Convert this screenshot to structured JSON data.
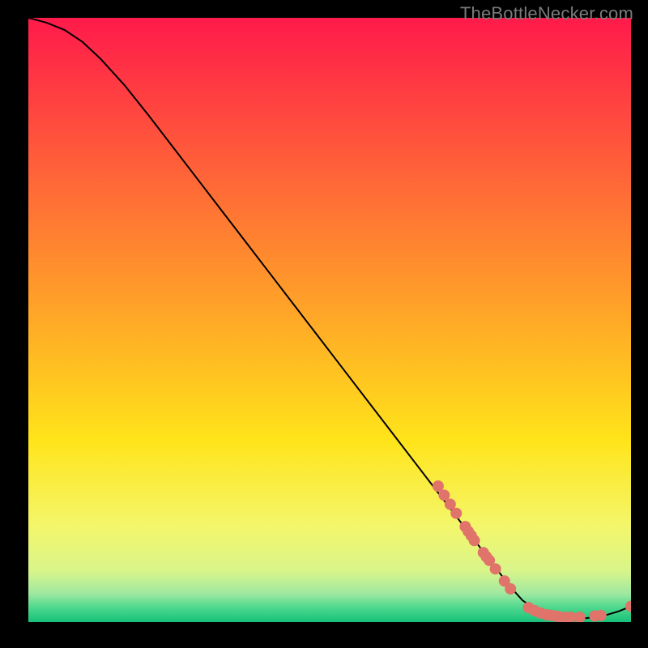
{
  "watermark": "TheBottleNecker.com",
  "chart_data": {
    "type": "line",
    "title": "",
    "xlabel": "",
    "ylabel": "",
    "xlim": [
      0,
      100
    ],
    "ylim": [
      0,
      100
    ],
    "grid": false,
    "legend": false,
    "background_gradient": {
      "stops": [
        {
          "offset": 0,
          "color": "#ff1a4b"
        },
        {
          "offset": 0.45,
          "color": "#ff9a2a"
        },
        {
          "offset": 0.7,
          "color": "#ffe41a"
        },
        {
          "offset": 0.84,
          "color": "#f4f66a"
        },
        {
          "offset": 0.915,
          "color": "#d9f58a"
        },
        {
          "offset": 0.953,
          "color": "#9fe8a0"
        },
        {
          "offset": 0.975,
          "color": "#4fd98e"
        },
        {
          "offset": 1.0,
          "color": "#17c07a"
        }
      ]
    },
    "series": [
      {
        "name": "curve",
        "color": "#000000",
        "x": [
          0,
          3,
          6,
          9,
          12,
          16,
          20,
          24,
          28,
          32,
          36,
          40,
          44,
          48,
          52,
          56,
          60,
          64,
          68,
          70,
          72,
          74,
          76,
          78,
          80,
          82,
          84,
          86,
          88,
          90,
          92,
          94,
          96,
          98,
          100
        ],
        "y": [
          100,
          99.2,
          98.0,
          96.0,
          93.2,
          88.8,
          83.8,
          78.6,
          73.4,
          68.2,
          63.0,
          57.8,
          52.6,
          47.4,
          42.2,
          37.0,
          31.8,
          26.6,
          21.4,
          18.8,
          16.2,
          13.6,
          11.0,
          8.4,
          5.8,
          3.6,
          2.2,
          1.3,
          0.8,
          0.6,
          0.6,
          0.8,
          1.2,
          1.8,
          2.6
        ]
      }
    ],
    "markers": {
      "name": "highlight-points",
      "color": "#e0736a",
      "radius": 7,
      "points": [
        {
          "x": 68.0,
          "y": 22.5
        },
        {
          "x": 69.0,
          "y": 21.0
        },
        {
          "x": 70.0,
          "y": 19.5
        },
        {
          "x": 71.0,
          "y": 18.0
        },
        {
          "x": 72.5,
          "y": 15.8
        },
        {
          "x": 73.0,
          "y": 15.0
        },
        {
          "x": 73.5,
          "y": 14.3
        },
        {
          "x": 74.0,
          "y": 13.5
        },
        {
          "x": 75.5,
          "y": 11.5
        },
        {
          "x": 76.0,
          "y": 10.8
        },
        {
          "x": 76.5,
          "y": 10.2
        },
        {
          "x": 77.5,
          "y": 8.8
        },
        {
          "x": 79.0,
          "y": 6.8
        },
        {
          "x": 80.0,
          "y": 5.5
        },
        {
          "x": 83.0,
          "y": 2.4
        },
        {
          "x": 84.0,
          "y": 1.9
        },
        {
          "x": 85.0,
          "y": 1.5
        },
        {
          "x": 86.0,
          "y": 1.2
        },
        {
          "x": 86.8,
          "y": 1.1
        },
        {
          "x": 87.5,
          "y": 1.0
        },
        {
          "x": 88.0,
          "y": 0.9
        },
        {
          "x": 89.0,
          "y": 0.8
        },
        {
          "x": 90.0,
          "y": 0.8
        },
        {
          "x": 91.5,
          "y": 0.8
        },
        {
          "x": 94.0,
          "y": 1.0
        },
        {
          "x": 95.0,
          "y": 1.1
        },
        {
          "x": 100.0,
          "y": 2.6
        }
      ]
    }
  }
}
